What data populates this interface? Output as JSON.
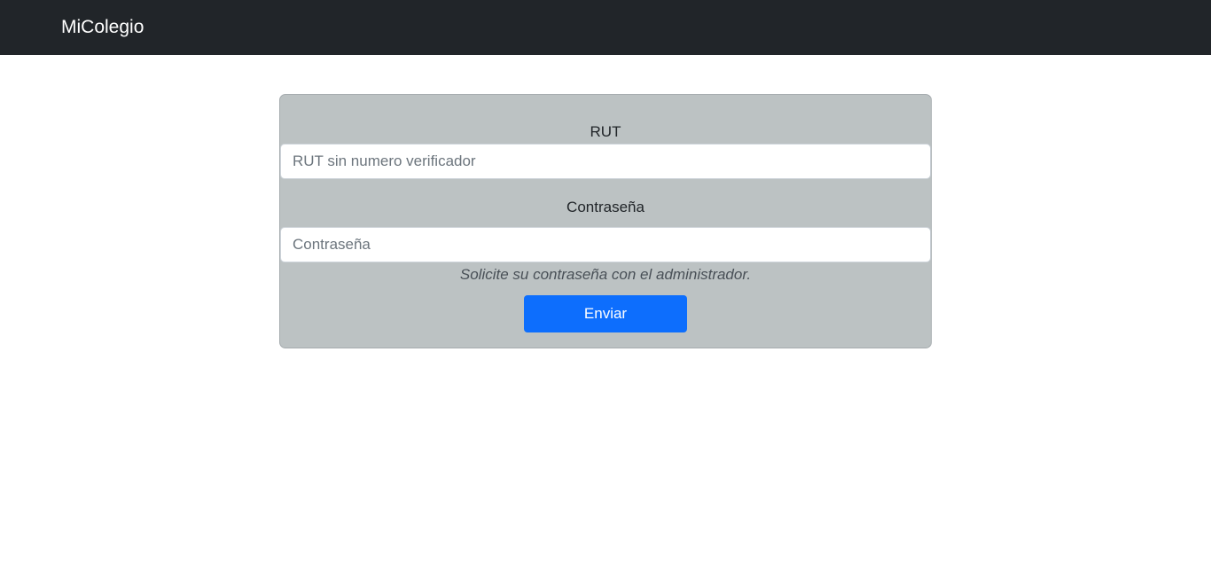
{
  "navbar": {
    "brand": "MiColegio"
  },
  "login_form": {
    "rut_label": "RUT",
    "rut_placeholder": "RUT sin numero verificador",
    "rut_value": "",
    "password_label": "Contraseña",
    "password_placeholder": "Contraseña",
    "password_value": "",
    "help_text": "Solicite su contraseña con el administrador.",
    "submit_label": "Enviar"
  },
  "colors": {
    "navbar_bg": "#212529",
    "card_bg": "#bcc2c3",
    "primary_button": "#0d6efd"
  }
}
